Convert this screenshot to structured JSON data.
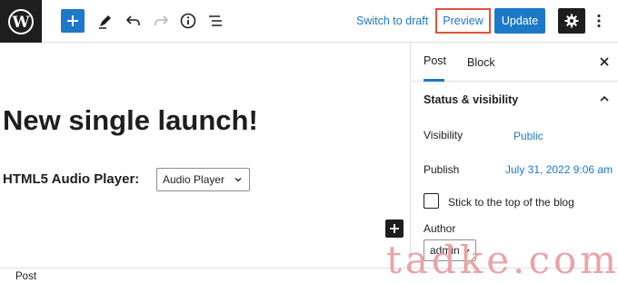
{
  "toolbar": {
    "switch_to_draft": "Switch to draft",
    "preview": "Preview",
    "update": "Update",
    "icons": [
      "wordpress-logo",
      "plus-icon",
      "pencil-icon",
      "undo-icon",
      "redo-icon",
      "info-icon",
      "list-view-icon",
      "gear-icon",
      "more-vertical-icon"
    ]
  },
  "editor": {
    "title": "New single launch!",
    "audio_label": "HTML5 Audio Player:",
    "audio_select_value": "Audio Player"
  },
  "sidebar": {
    "tabs": [
      {
        "label": "Post",
        "active": true
      },
      {
        "label": "Block",
        "active": false
      }
    ],
    "panel_title": "Status & visibility",
    "visibility_label": "Visibility",
    "visibility_value": "Public",
    "publish_label": "Publish",
    "publish_value": "July 31, 2022 9:06 am",
    "stick_label": "Stick to the top of the blog",
    "author_label": "Author",
    "author_value": "admin"
  },
  "footer": {
    "breadcrumb": "Post"
  },
  "watermark": "tadke.com",
  "colors": {
    "accent": "#1e78c8",
    "highlight_border": "#e0523a",
    "dark": "#1e1e1e"
  }
}
